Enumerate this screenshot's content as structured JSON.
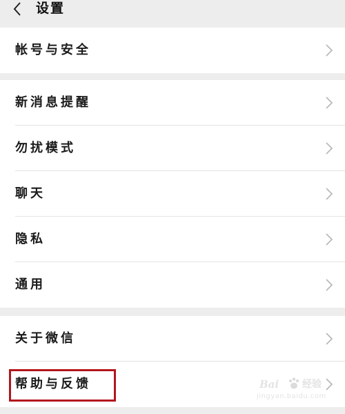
{
  "header": {
    "title": "设置",
    "back_icon": "chevron-left-icon"
  },
  "groups": [
    {
      "items": [
        {
          "label": "帐号与安全"
        }
      ]
    },
    {
      "items": [
        {
          "label": "新消息提醒"
        },
        {
          "label": "勿扰模式"
        },
        {
          "label": "聊天"
        },
        {
          "label": "隐私"
        },
        {
          "label": "通用"
        }
      ]
    },
    {
      "items": [
        {
          "label": "关于微信"
        },
        {
          "label": "帮助与反馈"
        }
      ]
    }
  ],
  "row_icon": "chevron-right-icon",
  "highlight_color": "#b3151c",
  "watermark": {
    "brand": "Bai",
    "brand_suffix": "经验",
    "url": "jingyan.baidu.com"
  }
}
